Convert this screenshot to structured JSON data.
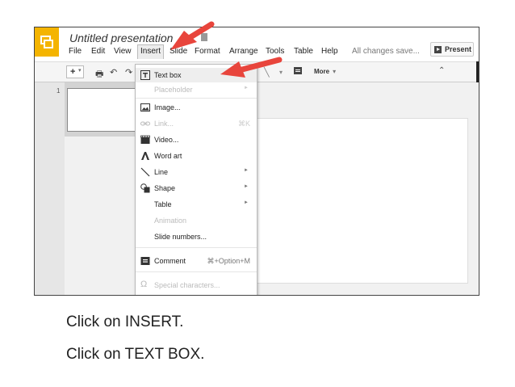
{
  "app": {
    "doc_title": "Untitled presentation",
    "brand_color": "#f4b400",
    "logo_icon": "slides-logo-icon"
  },
  "menubar": {
    "items": [
      "File",
      "Edit",
      "View",
      "Insert",
      "Slide",
      "Format",
      "Arrange",
      "Tools",
      "Table",
      "Help"
    ],
    "active": "Insert",
    "save_status": "All changes save..."
  },
  "present_button": {
    "label": "Present",
    "icon": "play-icon"
  },
  "toolbar": {
    "add_label": "+",
    "more_label": "More",
    "icons": [
      "print-icon",
      "undo-icon",
      "redo-icon",
      "comment-icon",
      "collapse-icon"
    ]
  },
  "filmstrip": {
    "slide_number": "1"
  },
  "insert_menu": {
    "items": [
      {
        "label": "Text box",
        "icon": "text-box-icon",
        "highlighted": true
      },
      {
        "label": "Placeholder",
        "disabled": true,
        "submenu": true
      },
      {
        "label": "Image...",
        "icon": "image-icon"
      },
      {
        "label": "Link...",
        "icon": "link-icon",
        "disabled": true,
        "shortcut": "⌘K"
      },
      {
        "label": "Video...",
        "icon": "video-icon"
      },
      {
        "label": "Word art",
        "icon": "word-art-icon"
      },
      {
        "label": "Line",
        "icon": "line-icon",
        "submenu": true
      },
      {
        "label": "Shape",
        "icon": "shape-icon",
        "submenu": true
      },
      {
        "label": "Table",
        "submenu": true
      },
      {
        "label": "Animation",
        "disabled": true
      },
      {
        "label": "Slide numbers..."
      },
      {
        "label": "Comment",
        "icon": "comment-icon",
        "shortcut": "⌘+Option+M"
      },
      {
        "label": "Special characters...",
        "icon": "omega-icon",
        "disabled": true
      }
    ],
    "submenu_glyph": "►"
  },
  "annotations": {
    "arrow_color": "#e8453c"
  },
  "captions": [
    "Click on INSERT.",
    "Click on TEXT BOX."
  ]
}
